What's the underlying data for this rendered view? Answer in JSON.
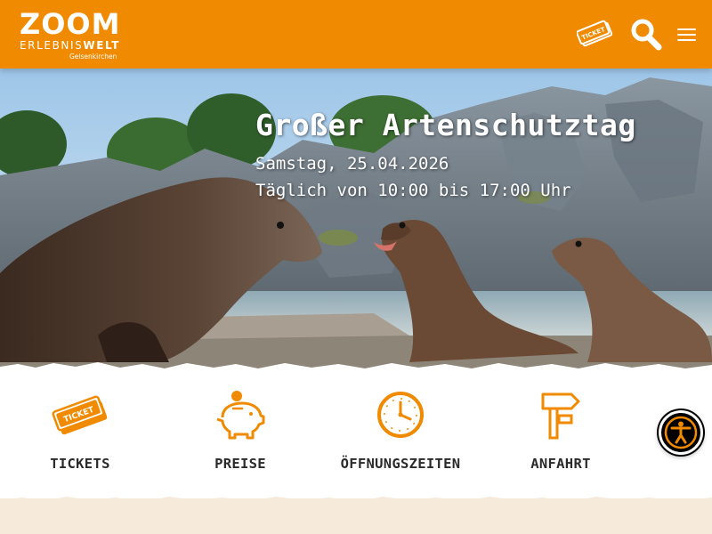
{
  "header": {
    "logo": {
      "word": "ZOOM",
      "sub_light": "ERLEBNIS",
      "sub_bold": "WELT",
      "city": "Gelsenkirchen"
    },
    "ticket_icon": "ticket-icon",
    "ticket_text": "TICKET",
    "search_icon": "search-icon",
    "menu_icon": "hamburger-menu-icon"
  },
  "hero": {
    "title": "Großer Artenschutztag",
    "date": "Samstag, 25.04.2026",
    "hours": "Täglich von 10:00 bis 17:00 Uhr",
    "image_subject": "sea lions on rocks"
  },
  "quicklinks": [
    {
      "label": "TICKETS",
      "icon": "ticket-icon",
      "ticket_text": "TICKET"
    },
    {
      "label": "PREISE",
      "icon": "piggy-bank-icon"
    },
    {
      "label": "ÖFFNUNGSZEITEN",
      "icon": "clock-icon"
    },
    {
      "label": "ANFAHRT",
      "icon": "signpost-icon"
    }
  ],
  "accessibility": {
    "icon": "accessibility-icon"
  },
  "colors": {
    "brand_orange": "#F08A00",
    "sand": "#F6EADB",
    "text_dark": "#2A2A2A"
  }
}
